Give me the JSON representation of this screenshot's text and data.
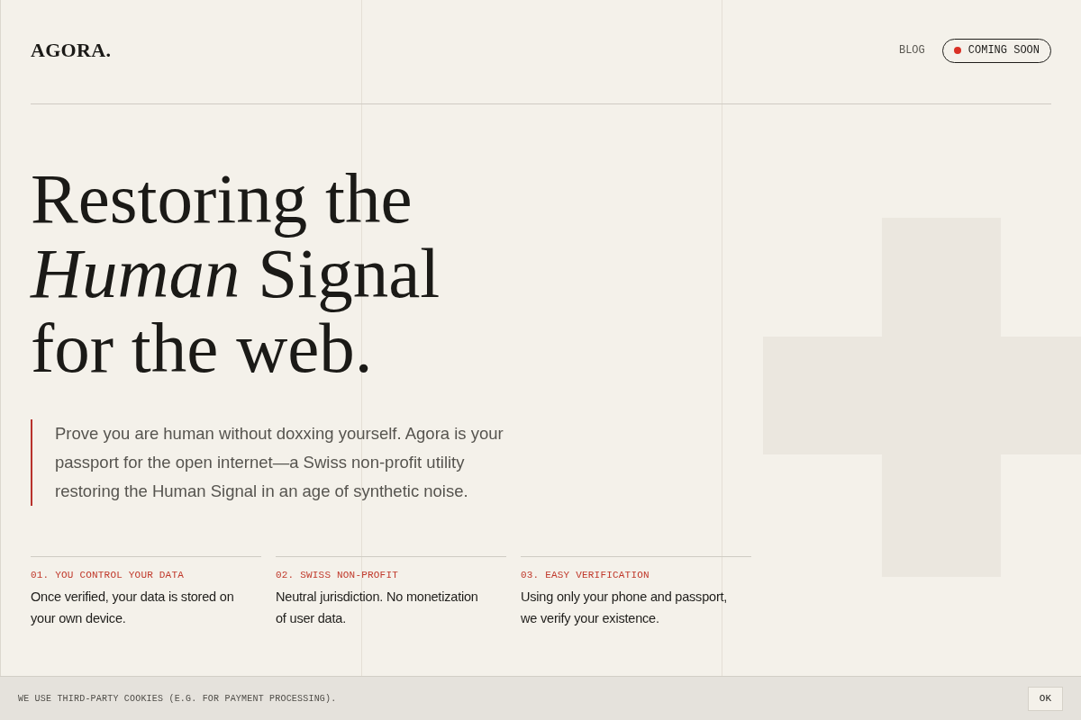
{
  "header": {
    "logo": "AGORA.",
    "nav": [
      {
        "kind": "link",
        "label": "BLOG"
      },
      {
        "kind": "status",
        "label": "COMING SOON",
        "color": "#d93025"
      }
    ]
  },
  "hero": {
    "headline_lines": [
      "Restoring the",
      "*Human* Signal",
      "for the web."
    ],
    "lead": "Prove you are human without doxxing yourself. Agora is your passport for the open internet—a Swiss non-profit utility restoring the Human Signal in an age of synthetic noise."
  },
  "features": [
    {
      "label": "01. YOU CONTROL YOUR DATA",
      "text": "Once verified, your data is stored on your own device."
    },
    {
      "label": "02. SWISS NON-PROFIT",
      "text": "Neutral jurisdiction. No monetization of user data."
    },
    {
      "label": "03. EASY VERIFICATION",
      "text": "Using only your phone and passport, we verify your existence."
    }
  ],
  "cookie_bar": {
    "text": "WE USE THIRD-PARTY COOKIES (E.G. FOR PAYMENT PROCESSING).",
    "button": "OK"
  }
}
